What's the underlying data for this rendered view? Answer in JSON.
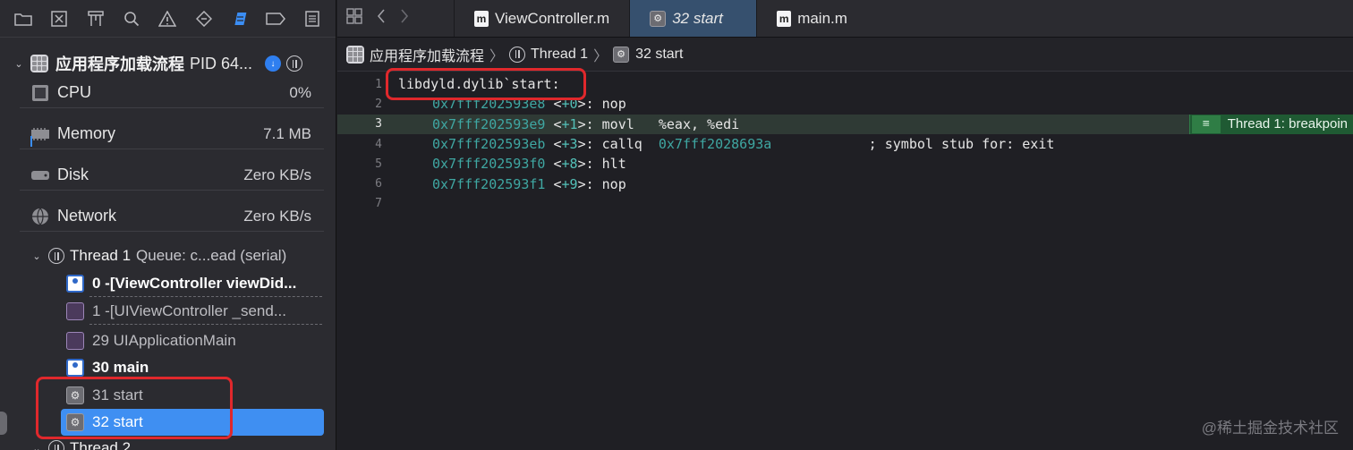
{
  "navigator": {
    "toolbar_icons": [
      "folder-icon",
      "source-control-icon",
      "hierarchy-icon",
      "search-icon",
      "warning-icon",
      "test-icon",
      "debug-icon",
      "breakpoint-icon",
      "report-icon"
    ],
    "process": {
      "name": "应用程序加载流程",
      "pid": "PID 64..."
    },
    "gauges": [
      {
        "label": "CPU",
        "value": "0%"
      },
      {
        "label": "Memory",
        "value": "7.1 MB"
      },
      {
        "label": "Disk",
        "value": "Zero KB/s"
      },
      {
        "label": "Network",
        "value": "Zero KB/s"
      }
    ],
    "thread1": {
      "title": "Thread 1",
      "queue": "Queue: c...ead (serial)"
    },
    "frames": [
      {
        "text": "0 -[ViewController viewDid...",
        "icon": "user"
      },
      {
        "text": "1 -[UIViewController _send...",
        "icon": "cup"
      },
      {
        "text": "29 UIApplicationMain",
        "icon": "cup"
      },
      {
        "text": "30 main",
        "icon": "user"
      },
      {
        "text": "31 start",
        "icon": "gear"
      },
      {
        "text": "32 start",
        "icon": "gear"
      }
    ],
    "thread2": {
      "title": "Thread 2"
    }
  },
  "editor": {
    "tabs": [
      {
        "label": "ViewController.m",
        "icon": "m"
      },
      {
        "label": "32 start",
        "icon": "gear",
        "active": true
      },
      {
        "label": "main.m",
        "icon": "m"
      }
    ],
    "jumpbar": {
      "app": "应用程序加载流程",
      "thread": "Thread 1",
      "frame": "32 start"
    },
    "lines": [
      {
        "num": "1",
        "label": "libdyld.dylib`start:"
      },
      {
        "num": "2",
        "addr": "0x7fff202593e8",
        "off": "+0",
        "instr": ">: nop"
      },
      {
        "num": "3",
        "addr": "0x7fff202593e9",
        "off": "+1",
        "instr": ">: movl   %eax, %edi"
      },
      {
        "num": "4",
        "addr": "0x7fff202593eb",
        "off": "+3",
        "instr": ">: callq  ",
        "target": "0x7fff2028693a",
        "comment": "            ; symbol stub for: exit"
      },
      {
        "num": "5",
        "addr": "0x7fff202593f0",
        "off": "+8",
        "instr": ">: hlt"
      },
      {
        "num": "6",
        "addr": "0x7fff202593f1",
        "off": "+9",
        "instr": ">: nop"
      },
      {
        "num": "7"
      }
    ],
    "breakpoint_badge": "Thread 1: breakpoin"
  },
  "watermark": "@稀土掘金技术社区",
  "colors": {
    "accent": "#3f8ff2",
    "highlight_box": "#e0282c",
    "address": "#3fa7a2"
  }
}
